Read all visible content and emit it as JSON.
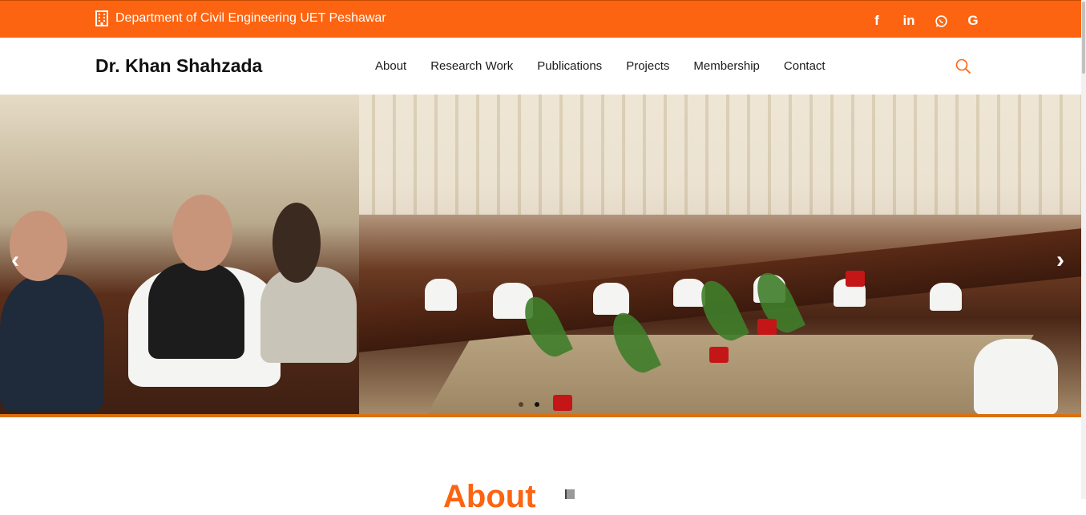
{
  "topbar": {
    "department": "Department of Civil Engineering UET Peshawar",
    "background_color": "#fd6411",
    "social": [
      {
        "icon": "facebook-icon",
        "glyph": "f"
      },
      {
        "icon": "linkedin-icon",
        "glyph": "in"
      },
      {
        "icon": "whatsapp-icon",
        "glyph": "◌"
      },
      {
        "icon": "google-icon",
        "glyph": "G"
      }
    ]
  },
  "navbar": {
    "brand": "Dr. Khan Shahzada",
    "menu": [
      "About",
      "Research Work",
      "Publications",
      "Projects",
      "Membership",
      "Contact"
    ],
    "search_icon": "search-icon"
  },
  "hero": {
    "prev_arrow": "‹",
    "next_arrow": "›",
    "slide_count": 2,
    "active_slide": 2,
    "accent_color": "#d9700f"
  },
  "section": {
    "about_heading": "About"
  }
}
